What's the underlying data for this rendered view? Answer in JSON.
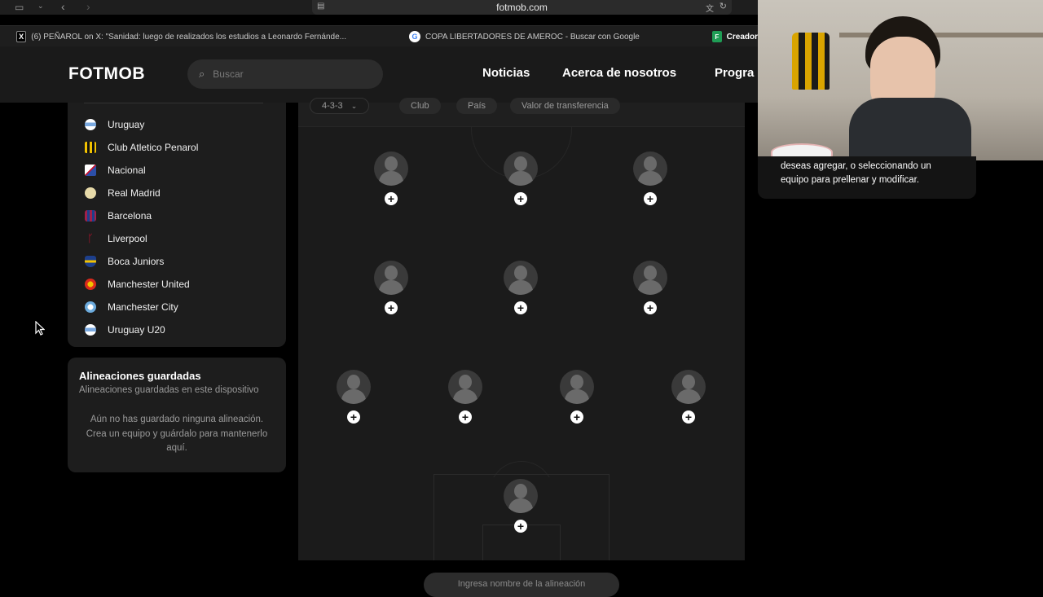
{
  "browser": {
    "url": "fotmob.com",
    "tabs": [
      {
        "label": "(6) PEÑAROL on X: \"Sanidad: luego de realizados los estudios a Leonardo Fernánde...",
        "icon": "x-icon"
      },
      {
        "label": "COPA LIBERTADORES DE AMEROC - Buscar con Google",
        "icon": "google-icon"
      },
      {
        "label": "Creador",
        "icon": "fotmob-icon"
      }
    ]
  },
  "nav": {
    "logo": "FOTMOB",
    "search_placeholder": "Buscar",
    "links": [
      "Noticias",
      "Acerca de nosotros",
      "Progra"
    ]
  },
  "teams": {
    "items": [
      {
        "label": "Uruguay",
        "color": "#7aa9e0"
      },
      {
        "label": "Club Atletico Penarol",
        "color": "#f2c200"
      },
      {
        "label": "Nacional",
        "color": "#2c4fa8"
      },
      {
        "label": "Real Madrid",
        "color": "#e6d9a8"
      },
      {
        "label": "Barcelona",
        "color": "#a1204a"
      },
      {
        "label": "Liverpool",
        "color": "#c8102e"
      },
      {
        "label": "Boca Juniors",
        "color": "#1d3f8c"
      },
      {
        "label": "Manchester United",
        "color": "#da291c"
      },
      {
        "label": "Manchester City",
        "color": "#6cabdd"
      },
      {
        "label": "Uruguay U20",
        "color": "#7aa9e0"
      }
    ]
  },
  "saved": {
    "title": "Alineaciones guardadas",
    "subtitle": "Alineaciones guardadas en este dispositivo",
    "empty": "Aún no has guardado ninguna alineación. Crea un equipo y guárdalo para mantenerlo aquí."
  },
  "pitch": {
    "formation": "4-3-3",
    "filters": [
      "Club",
      "País",
      "Valor de transferencia"
    ],
    "name_placeholder": "Ingresa nombre de la alineación"
  },
  "caption": {
    "text": "deseas agregar, o seleccionando un equipo para prellenar y modificar."
  }
}
